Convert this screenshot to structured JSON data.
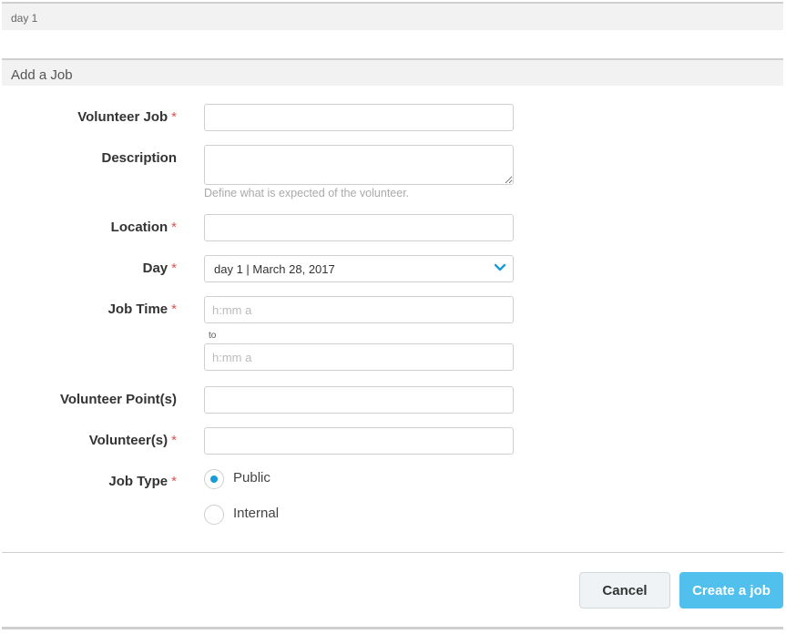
{
  "topbar": {
    "text": "day 1"
  },
  "section": {
    "title": "Add a Job"
  },
  "form": {
    "required_mark": "*",
    "volunteer_job": {
      "label": "Volunteer Job",
      "value": ""
    },
    "description": {
      "label": "Description",
      "value": "",
      "help": "Define what is expected of the volunteer."
    },
    "location": {
      "label": "Location",
      "value": ""
    },
    "day": {
      "label": "Day",
      "selected": "day 1 | March 28, 2017"
    },
    "job_time": {
      "label": "Job Time",
      "start_placeholder": "h:mm a",
      "to_label": "to",
      "end_placeholder": "h:mm a"
    },
    "volunteer_points": {
      "label": "Volunteer Point(s)",
      "value": ""
    },
    "volunteers": {
      "label": "Volunteer(s)",
      "value": ""
    },
    "job_type": {
      "label": "Job Type",
      "options": [
        {
          "label": "Public",
          "selected": true
        },
        {
          "label": "Internal",
          "selected": false
        }
      ]
    }
  },
  "actions": {
    "cancel_label": "Cancel",
    "create_label": "Create a job"
  },
  "colors": {
    "accent": "#1a9bd7",
    "primary_button": "#52c0ec",
    "required": "#d9534f"
  }
}
